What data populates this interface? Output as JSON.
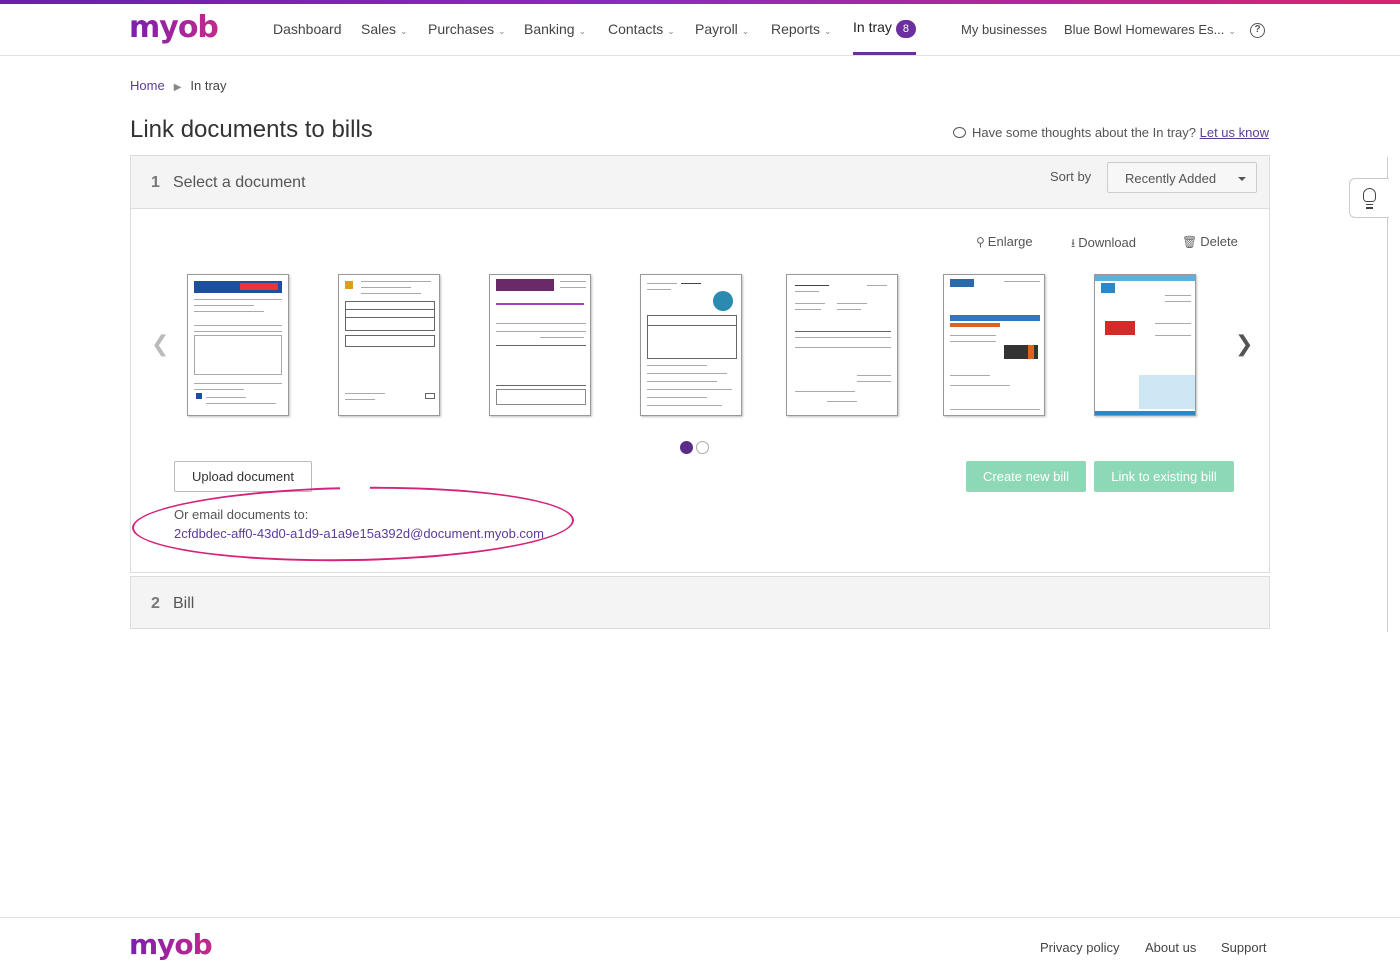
{
  "brand": {
    "logo_text": "myob"
  },
  "nav": {
    "items": [
      {
        "label": "Dashboard",
        "has_menu": false
      },
      {
        "label": "Sales",
        "has_menu": true
      },
      {
        "label": "Purchases",
        "has_menu": true
      },
      {
        "label": "Banking",
        "has_menu": true
      },
      {
        "label": "Contacts",
        "has_menu": true
      },
      {
        "label": "Payroll",
        "has_menu": true
      },
      {
        "label": "Reports",
        "has_menu": true
      }
    ],
    "intray": {
      "label": "In tray",
      "count": "8",
      "active": true
    },
    "my_businesses": "My businesses",
    "business_name": "Blue Bowl Homewares Es...",
    "help_glyph": "?"
  },
  "breadcrumb": {
    "home": "Home",
    "current": "In tray"
  },
  "page": {
    "title": "Link documents to bills",
    "feedback_text": "Have some thoughts about the In tray?",
    "feedback_link": "Let us know"
  },
  "step1": {
    "number": "1",
    "label": "Select a document",
    "sort_label": "Sort by",
    "sort_value": "Recently Added",
    "actions": {
      "enlarge": "Enlarge",
      "download": "Download",
      "delete": "Delete"
    },
    "documents_count": 7,
    "carousel_pages": 2,
    "carousel_active_page": 1,
    "upload_button": "Upload document",
    "create_bill_button": "Create new bill",
    "link_bill_button": "Link to existing bill",
    "email_label": "Or email documents to:",
    "email_address": "2cfdbdec-aff0-43d0-a1d9-a1a9e15a392d@document.myob.com"
  },
  "step2": {
    "number": "2",
    "label": "Bill"
  },
  "footer": {
    "logo_text": "myob",
    "links": [
      "Privacy policy",
      "About us",
      "Support"
    ]
  },
  "colors": {
    "brand_purple": "#6b2fa0",
    "brand_gradient_end": "#d8236f",
    "annotation_pink": "#d6237a",
    "disabled_green": "#8ed9b5"
  }
}
